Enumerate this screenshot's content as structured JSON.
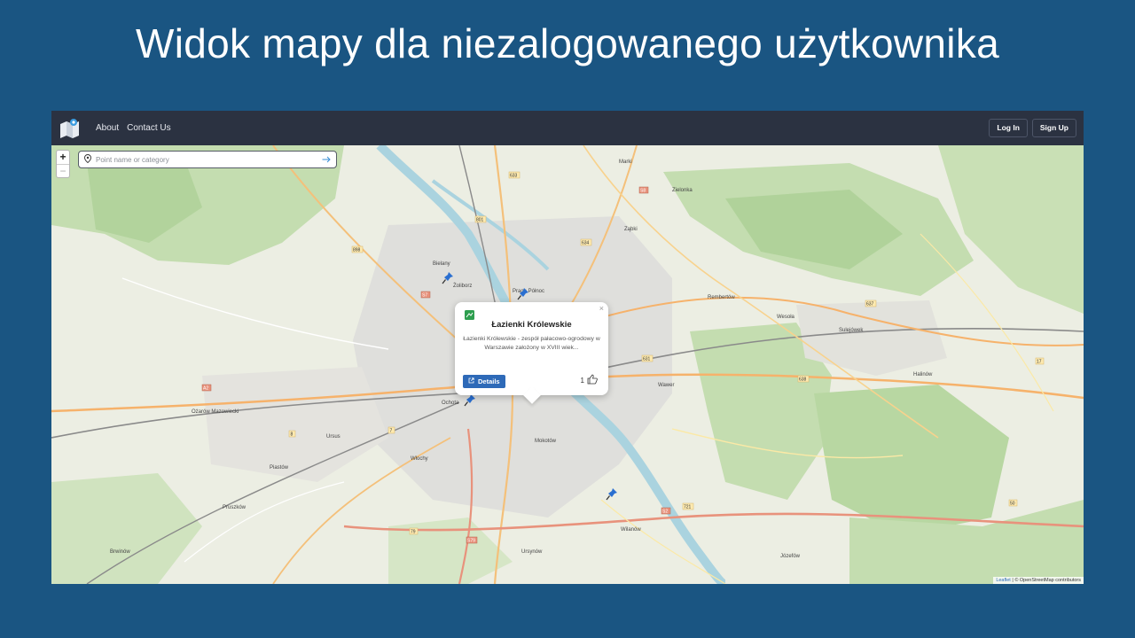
{
  "slide": {
    "title": "Widok mapy dla niezalogowanego użytkownika"
  },
  "navbar": {
    "links": [
      "About",
      "Contact Us"
    ],
    "login_label": "Log In",
    "signup_label": "Sign Up"
  },
  "map": {
    "zoom_in": "+",
    "zoom_out": "−",
    "search_placeholder": "Point name or category",
    "labels": {
      "marki": "Marki",
      "zielonka": "Zielonka",
      "zabki": "Ząbki",
      "bielany": "Bielany",
      "zoliborz": "Żoliborz",
      "praga": "Praga Północ",
      "wesola": "Wesoła",
      "sulejowek": "Sulejówek",
      "ochota": "Ochota",
      "ozarow": "Ożarów Mazowiecki",
      "mokotow": "Mokotów",
      "ursus": "Ursus",
      "wlochy": "Włochy",
      "piastow": "Piastów",
      "pruszkow": "Pruszków",
      "brwinow": "Brwinów",
      "wilanow": "Wilanów",
      "jozefow": "Józefów",
      "rembertow": "Rembertów",
      "halinow": "Halinów",
      "wawer": "Wawer",
      "ursynow": "Ursynów"
    },
    "roads": [
      "633",
      "801",
      "634",
      "898",
      "631",
      "637",
      "638",
      "S8",
      "S7",
      "S2",
      "S79",
      "A2",
      "7",
      "8",
      "17",
      "50",
      "79",
      "721"
    ]
  },
  "popup": {
    "close": "×",
    "title": "Łazienki Królewskie",
    "description": "Łazienki Królewskie - zespół pałacowo-ogrodowy w Warszawie założony w XVIII wiek...",
    "details_label": "Details",
    "likes": "1"
  },
  "attribution": {
    "leaflet": "Leaflet",
    "rest": " | © OpenStreetMap contributors"
  },
  "colors": {
    "slide_bg": "#1a5582",
    "navbar": "#2b3241",
    "details_button": "#2e6ab8",
    "pin": "#2a6fd0"
  }
}
